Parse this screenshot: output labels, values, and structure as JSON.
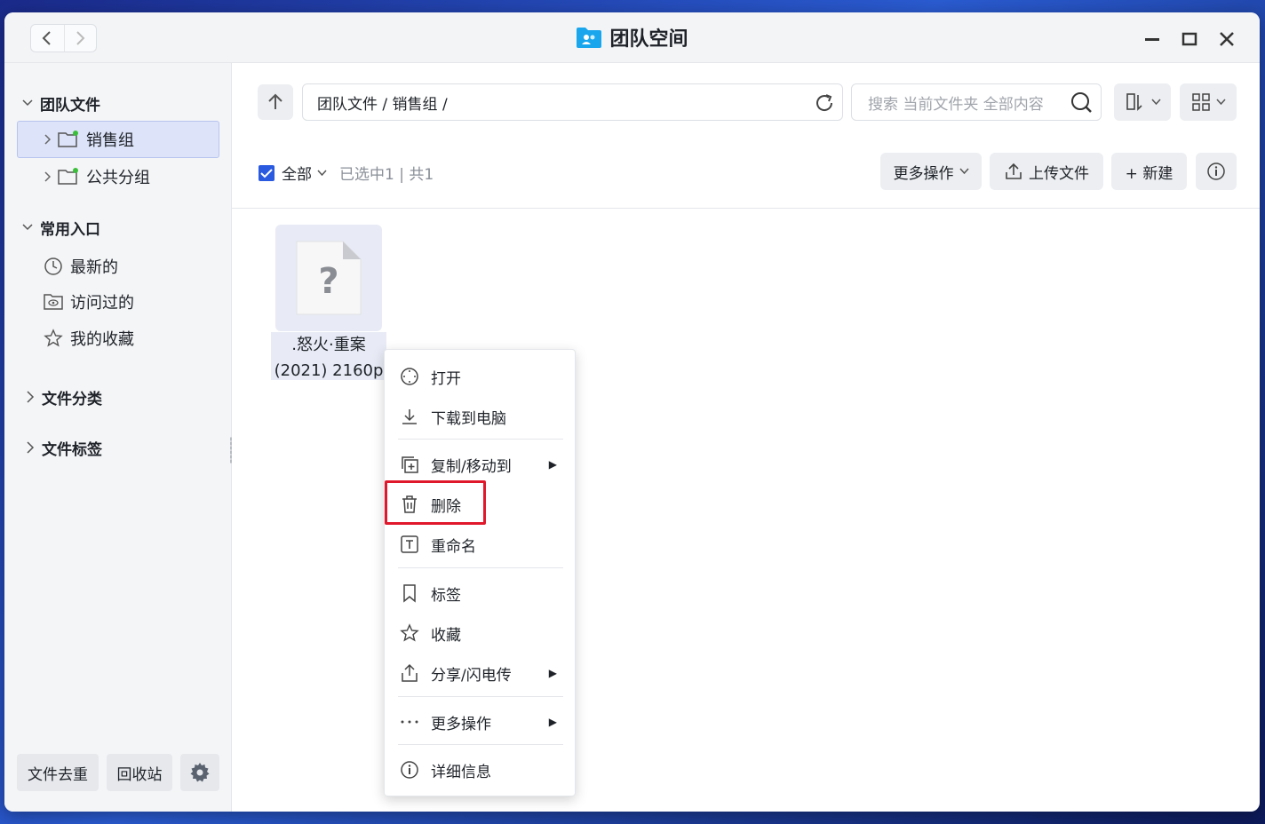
{
  "window": {
    "title": "团队空间",
    "accent": "#2a5ae0",
    "highlight_color": "#e0182b"
  },
  "sidebar": {
    "team_files_label": "团队文件",
    "groups": [
      {
        "label": "销售组",
        "selected": true
      },
      {
        "label": "公共分组",
        "selected": false
      }
    ],
    "common_label": "常用入口",
    "common_items": [
      {
        "label": "最新的",
        "icon": "clock-icon"
      },
      {
        "label": "访问过的",
        "icon": "visited-folder-icon"
      },
      {
        "label": "我的收藏",
        "icon": "star-icon"
      }
    ],
    "category_label": "文件分类",
    "tags_label": "文件标签",
    "dedup_label": "文件去重",
    "recycle_label": "回收站"
  },
  "toolbar": {
    "path": "团队文件 / 销售组 /",
    "search_placeholder": "搜索 当前文件夹 全部内容",
    "select_all_label": "全部",
    "selection_status": "已选中1 | 共1",
    "more_ops_label": "更多操作",
    "upload_label": "上传文件",
    "new_label": "+ 新建"
  },
  "files": [
    {
      "name": ".怒火·重案 (2021) 2160p EAC...",
      "icon": "unknown-file-icon"
    }
  ],
  "context_menu": {
    "items": [
      {
        "label": "打开",
        "icon": "open-icon",
        "submenu": false
      },
      {
        "label": "下载到电脑",
        "icon": "download-icon",
        "submenu": false
      },
      {
        "label": "复制/移动到",
        "icon": "copy-icon",
        "submenu": true
      },
      {
        "label": "删除",
        "icon": "trash-icon",
        "submenu": false
      },
      {
        "label": "重命名",
        "icon": "rename-icon",
        "submenu": false
      },
      {
        "label": "标签",
        "icon": "bookmark-icon",
        "submenu": false
      },
      {
        "label": "收藏",
        "icon": "star-icon",
        "submenu": false
      },
      {
        "label": "分享/闪电传",
        "icon": "share-icon",
        "submenu": true
      },
      {
        "label": "更多操作",
        "icon": "more-icon",
        "submenu": true
      },
      {
        "label": "详细信息",
        "icon": "info-icon",
        "submenu": false
      }
    ]
  }
}
